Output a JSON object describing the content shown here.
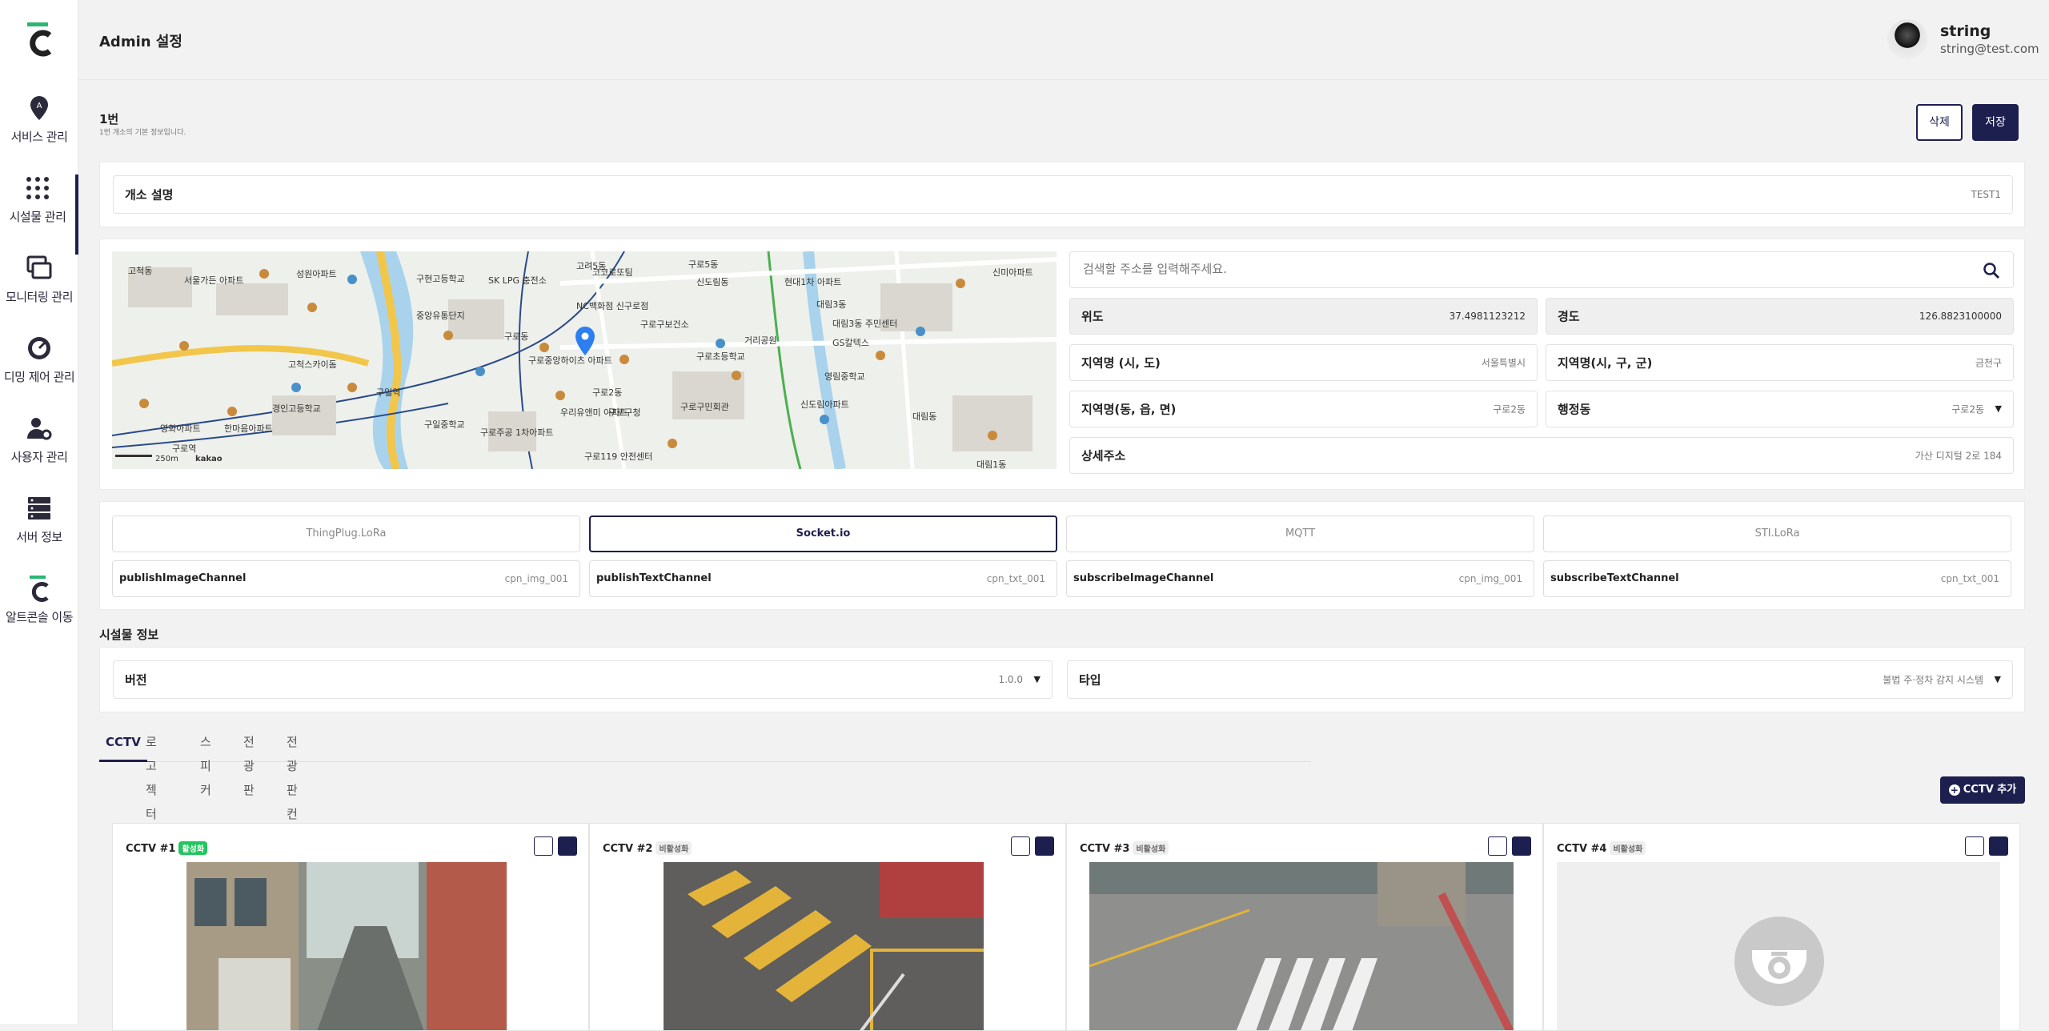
{
  "sidebar": {
    "items": [
      {
        "label": "서비스 관리",
        "icon": "location-pin-icon"
      },
      {
        "label": "시설물 관리",
        "icon": "grid-icon",
        "active": true
      },
      {
        "label": "모니터링 관리",
        "icon": "monitors-icon"
      },
      {
        "label": "디밍 제어 관리",
        "icon": "dimming-gauge-icon"
      },
      {
        "label": "사용자 관리",
        "icon": "user-settings-icon"
      },
      {
        "label": "서버 정보",
        "icon": "server-icon"
      },
      {
        "label": "알트콘솔 이동",
        "icon": "altconsole-logo-icon"
      }
    ]
  },
  "header": {
    "title": "Admin 설정",
    "user_name": "string",
    "user_email": "string@test.com"
  },
  "section": {
    "title": "1번",
    "subtitle": "1번 개소의 기본 정보입니다.",
    "delete_label": "삭제",
    "save_label": "저장"
  },
  "site": {
    "label": "개소 설명",
    "value": "TEST1"
  },
  "map": {
    "labels": [
      "고려5동",
      "고척동",
      "신도림동",
      "현대1차 아파트",
      "대림3동",
      "구로5동",
      "서울가든 아파트",
      "성원아파트",
      "구현고등학교",
      "SK LPG 충전소",
      "코코로또팀",
      "NC백화점 신구로점",
      "구로중앙하이츠 아파트",
      "구로2동",
      "구로구청",
      "구로구보건소",
      "구로초등학교",
      "거리공원",
      "GS칼텍스",
      "영림중학교",
      "구로동",
      "구일역",
      "고척스카이돔",
      "경인고등학교",
      "구일중학교",
      "구로주공 1차아파트",
      "신도림아파트",
      "대림동",
      "신미아파트",
      "영화아파트",
      "한마음아파트",
      "구로역",
      "대림1동",
      "구로구민회관",
      "우리유앤미 아파트",
      "중앙유통단지",
      "구로119 안전센터",
      "대림3동 주민센터"
    ],
    "scale": "250m",
    "brand": "kakao"
  },
  "address": {
    "search_placeholder": "검색할 주소를 입력해주세요.",
    "lat_label": "위도",
    "lat_value": "37.4981123212",
    "lng_label": "경도",
    "lng_value": "126.8823100000",
    "region1_label": "지역명 (시, 도)",
    "region1_value": "서울특별시",
    "region2_label": "지역명(시, 구, 군)",
    "region2_value": "금천구",
    "region3_label": "지역명(동, 읍, 면)",
    "region3_value": "구로2동",
    "admin_label": "행정동",
    "admin_value": "구로2동",
    "detail_label": "상세주소",
    "detail_value": "가산 디지털 2로 184"
  },
  "protocols": [
    {
      "label": "ThingPlug.LoRa",
      "active": false
    },
    {
      "label": "Socket.io",
      "active": true
    },
    {
      "label": "MQTT",
      "active": false
    },
    {
      "label": "STI.LoRa",
      "active": false
    }
  ],
  "channels": [
    {
      "label": "publishImageChannel",
      "value": "cpn_img_001"
    },
    {
      "label": "publishTextChannel",
      "value": "cpn_txt_001"
    },
    {
      "label": "subscribeImageChannel",
      "value": "cpn_img_001"
    },
    {
      "label": "subscribeTextChannel",
      "value": "cpn_txt_001"
    }
  ],
  "facility": {
    "title": "시설물 정보",
    "version_label": "버전",
    "version_value": "1.0.0",
    "type_label": "타입",
    "type_value": "불법 주·정차 감지 시스템"
  },
  "tabs": [
    "CCTV",
    "로고젝터",
    "스피커",
    "전광판",
    "전광판 컨텐츠"
  ],
  "add_cctv_label": "CCTV 추가",
  "cctvs": [
    {
      "name": "CCTV #1",
      "status": "활성화",
      "active": true
    },
    {
      "name": "CCTV #2",
      "status": "비활성화",
      "active": false
    },
    {
      "name": "CCTV #3",
      "status": "비활성화",
      "active": false
    },
    {
      "name": "CCTV #4",
      "status": "비활성화",
      "active": false
    }
  ],
  "colors": {
    "brand": "#1d1f4f",
    "accent_green": "#22c55e",
    "logo_green": "#2bb673"
  }
}
